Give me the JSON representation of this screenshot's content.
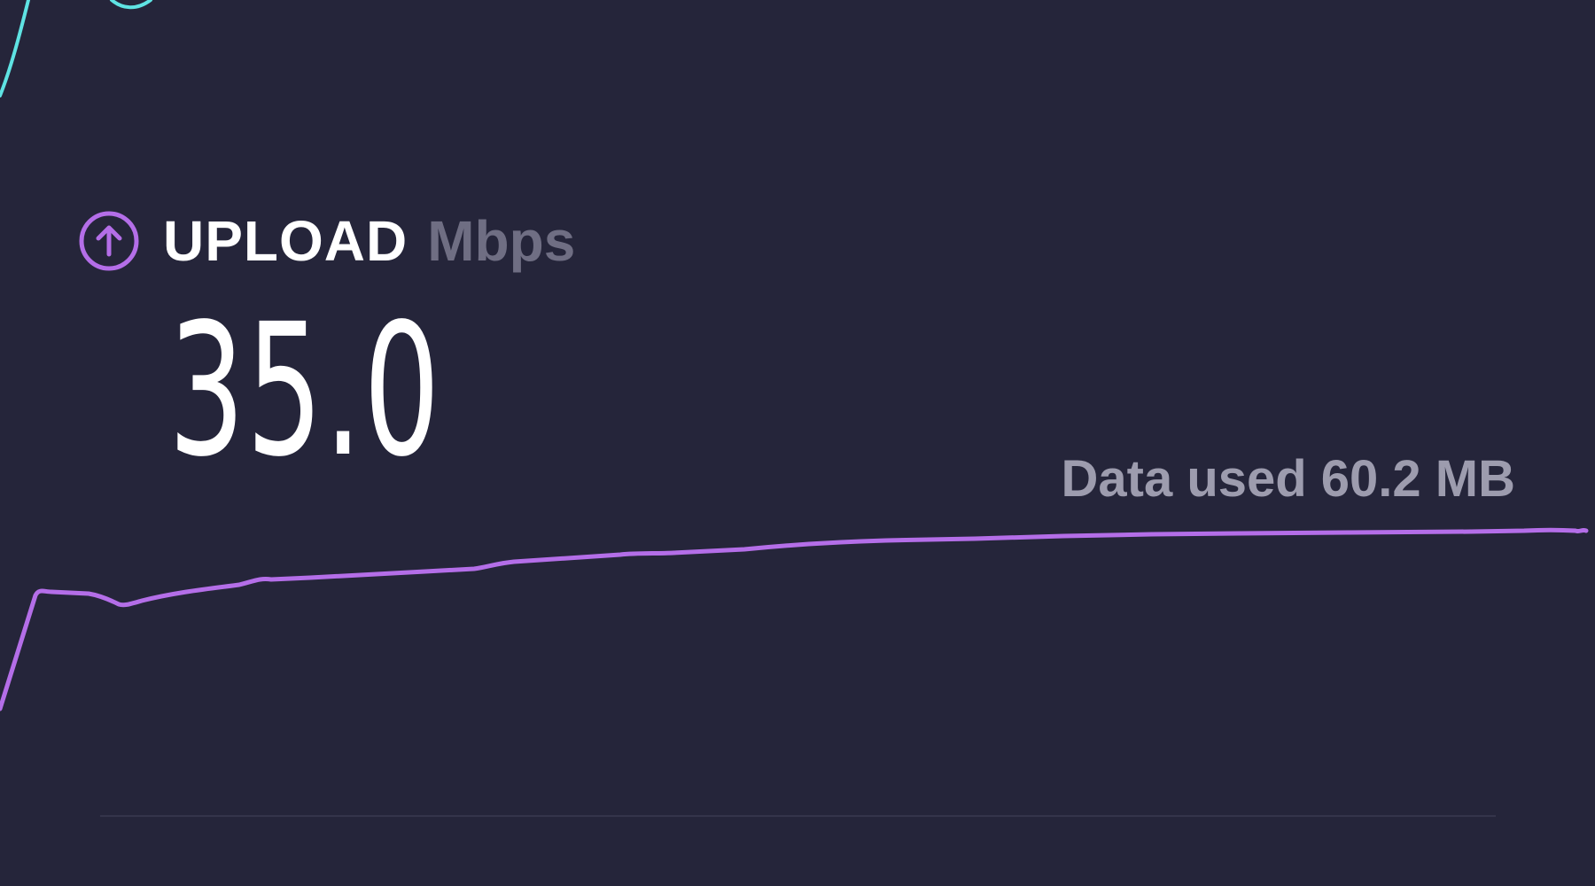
{
  "upload": {
    "label": "UPLOAD",
    "unit": "Mbps",
    "value": "35.0",
    "data_used": "Data used 60.2 MB"
  },
  "icons": {
    "upload": "arrow-up-circle-icon"
  },
  "colors": {
    "background": "#25253a",
    "upload_accent": "#b46ee8",
    "download_accent": "#5fe3e3",
    "label": "#ffffff",
    "unit": "#6f6e83",
    "data_used": "#9d9cae",
    "divider": "#34344a"
  }
}
